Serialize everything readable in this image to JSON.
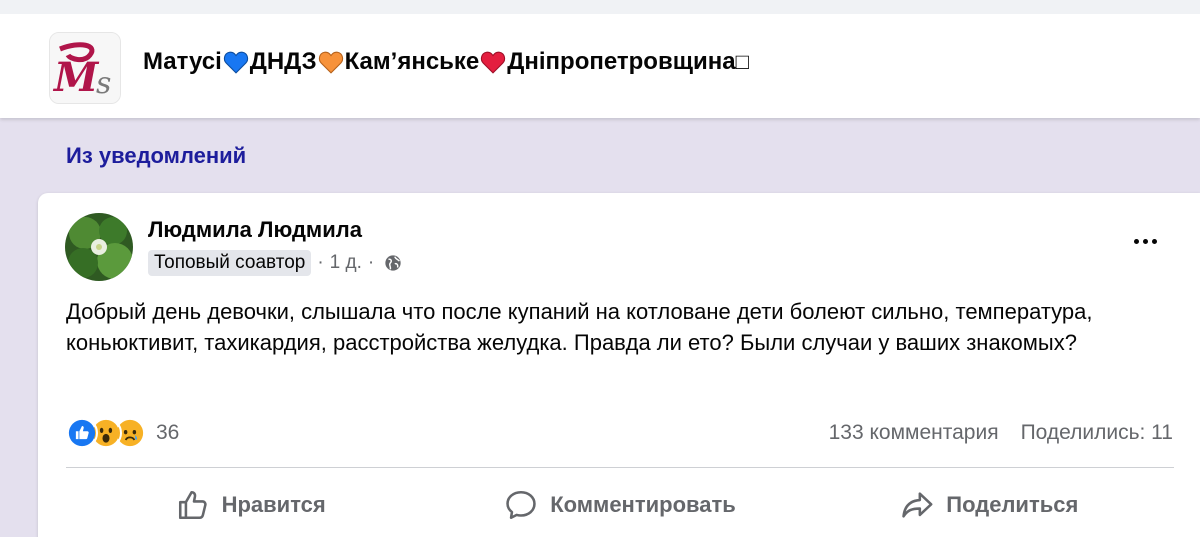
{
  "group": {
    "name_part1": "Матусі ",
    "name_part2": "ДНДЗ",
    "name_part3": "Кам’янське",
    "name_part4": "Дніпропетровщина",
    "trailing_glyph": "□",
    "logo_text": "Ms",
    "heart_colors": [
      "#1877f2",
      "#f7923a",
      "#e41e3f"
    ]
  },
  "context_label": "Из уведомлений",
  "post": {
    "author": "Людмила Людмила",
    "badge": "Топовый соавтор",
    "time": "1 д.",
    "separator": "·",
    "text": "Добрый день девочки, слышала что после купаний на котловане дети болеют сильно, температура, коньюктивит, тахикардия, расстройства желудка. Правда ли ето? Были случаи у ваших знакомых?",
    "reaction_count": "36",
    "reactions": [
      "like-icon",
      "wow-icon",
      "sad-icon"
    ],
    "comments": "133 комментария",
    "shares": "Поделились: 11"
  },
  "actions": {
    "like": "Нравится",
    "comment": "Комментировать",
    "share": "Поделиться"
  }
}
